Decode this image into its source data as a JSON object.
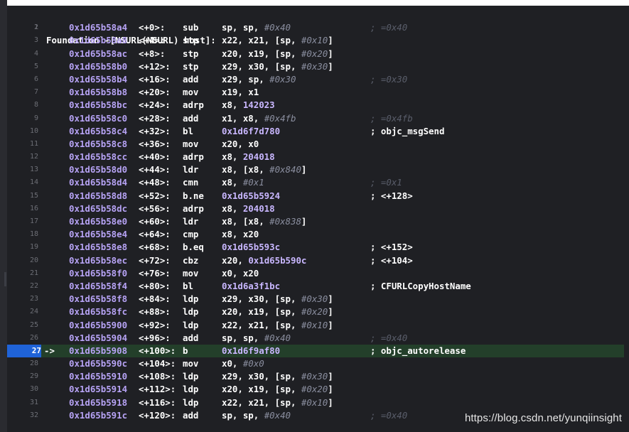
{
  "title": "Foundation`-[NSURL(NSURL) host]:",
  "current_line": 27,
  "arrow": "->",
  "rows": [
    {
      "ln": "2",
      "addr": "0x1d65b58a4",
      "off": "<+0>:",
      "mn": "sub",
      "ops": [
        [
          "sp, sp, ",
          ""
        ],
        [
          "#0x40",
          "i"
        ]
      ],
      "cm": "; =0x40",
      "cmType": "dim"
    },
    {
      "ln": "3",
      "addr": "0x1d65b58a8",
      "off": "<+4>:",
      "mn": "stp",
      "ops": [
        [
          "x22, x21, [sp, ",
          ""
        ],
        [
          "#0x10",
          "i"
        ],
        [
          "]",
          ""
        ]
      ],
      "cm": "",
      "cmType": ""
    },
    {
      "ln": "4",
      "addr": "0x1d65b58ac",
      "off": "<+8>:",
      "mn": "stp",
      "ops": [
        [
          "x20, x19, [sp, ",
          ""
        ],
        [
          "#0x20",
          "i"
        ],
        [
          "]",
          ""
        ]
      ],
      "cm": "",
      "cmType": ""
    },
    {
      "ln": "5",
      "addr": "0x1d65b58b0",
      "off": "<+12>:",
      "mn": "stp",
      "ops": [
        [
          "x29, x30, [sp, ",
          ""
        ],
        [
          "#0x30",
          "i"
        ],
        [
          "]",
          ""
        ]
      ],
      "cm": "",
      "cmType": ""
    },
    {
      "ln": "6",
      "addr": "0x1d65b58b4",
      "off": "<+16>:",
      "mn": "add",
      "ops": [
        [
          "x29, sp, ",
          ""
        ],
        [
          "#0x30",
          "i"
        ]
      ],
      "cm": "; =0x30",
      "cmType": "dim"
    },
    {
      "ln": "7",
      "addr": "0x1d65b58b8",
      "off": "<+20>:",
      "mn": "mov",
      "ops": [
        [
          "x19, x1",
          ""
        ]
      ],
      "cm": "",
      "cmType": ""
    },
    {
      "ln": "8",
      "addr": "0x1d65b58bc",
      "off": "<+24>:",
      "mn": "adrp",
      "ops": [
        [
          "x8, ",
          ""
        ],
        [
          "142023",
          "v"
        ]
      ],
      "cm": "",
      "cmType": ""
    },
    {
      "ln": "9",
      "addr": "0x1d65b58c0",
      "off": "<+28>:",
      "mn": "add",
      "ops": [
        [
          "x1, x8, ",
          ""
        ],
        [
          "#0x4fb",
          "i"
        ]
      ],
      "cm": "; =0x4fb",
      "cmType": "dim"
    },
    {
      "ln": "10",
      "addr": "0x1d65b58c4",
      "off": "<+32>:",
      "mn": "bl",
      "ops": [
        [
          "0x1d6f7d780",
          "v"
        ]
      ],
      "cm": "; objc_msgSend",
      "cmType": "sym"
    },
    {
      "ln": "11",
      "addr": "0x1d65b58c8",
      "off": "<+36>:",
      "mn": "mov",
      "ops": [
        [
          "x20, x0",
          ""
        ]
      ],
      "cm": "",
      "cmType": ""
    },
    {
      "ln": "12",
      "addr": "0x1d65b58cc",
      "off": "<+40>:",
      "mn": "adrp",
      "ops": [
        [
          "x8, ",
          ""
        ],
        [
          "204018",
          "v"
        ]
      ],
      "cm": "",
      "cmType": ""
    },
    {
      "ln": "13",
      "addr": "0x1d65b58d0",
      "off": "<+44>:",
      "mn": "ldr",
      "ops": [
        [
          "x8, [x8, ",
          ""
        ],
        [
          "#0x840",
          "i"
        ],
        [
          "]",
          ""
        ]
      ],
      "cm": "",
      "cmType": ""
    },
    {
      "ln": "14",
      "addr": "0x1d65b58d4",
      "off": "<+48>:",
      "mn": "cmn",
      "ops": [
        [
          "x8, ",
          ""
        ],
        [
          "#0x1",
          "i"
        ]
      ],
      "cm": "; =0x1",
      "cmType": "dim"
    },
    {
      "ln": "15",
      "addr": "0x1d65b58d8",
      "off": "<+52>:",
      "mn": "b.ne",
      "ops": [
        [
          "0x1d65b5924",
          "v"
        ]
      ],
      "cm": "; <+128>",
      "cmType": "sym"
    },
    {
      "ln": "16",
      "addr": "0x1d65b58dc",
      "off": "<+56>:",
      "mn": "adrp",
      "ops": [
        [
          "x8, ",
          ""
        ],
        [
          "204018",
          "v"
        ]
      ],
      "cm": "",
      "cmType": ""
    },
    {
      "ln": "17",
      "addr": "0x1d65b58e0",
      "off": "<+60>:",
      "mn": "ldr",
      "ops": [
        [
          "x8, [x8, ",
          ""
        ],
        [
          "#0x838",
          "i"
        ],
        [
          "]",
          ""
        ]
      ],
      "cm": "",
      "cmType": ""
    },
    {
      "ln": "18",
      "addr": "0x1d65b58e4",
      "off": "<+64>:",
      "mn": "cmp",
      "ops": [
        [
          "x8, x20",
          ""
        ]
      ],
      "cm": "",
      "cmType": ""
    },
    {
      "ln": "19",
      "addr": "0x1d65b58e8",
      "off": "<+68>:",
      "mn": "b.eq",
      "ops": [
        [
          "0x1d65b593c",
          "v"
        ]
      ],
      "cm": "; <+152>",
      "cmType": "sym"
    },
    {
      "ln": "20",
      "addr": "0x1d65b58ec",
      "off": "<+72>:",
      "mn": "cbz",
      "ops": [
        [
          "x20, ",
          ""
        ],
        [
          "0x1d65b590c",
          "v"
        ]
      ],
      "cm": "; <+104>",
      "cmType": "sym"
    },
    {
      "ln": "21",
      "addr": "0x1d65b58f0",
      "off": "<+76>:",
      "mn": "mov",
      "ops": [
        [
          "x0, x20",
          ""
        ]
      ],
      "cm": "",
      "cmType": ""
    },
    {
      "ln": "22",
      "addr": "0x1d65b58f4",
      "off": "<+80>:",
      "mn": "bl",
      "ops": [
        [
          "0x1d6a3f1bc",
          "v"
        ]
      ],
      "cm": "; CFURLCopyHostName",
      "cmType": "sym"
    },
    {
      "ln": "23",
      "addr": "0x1d65b58f8",
      "off": "<+84>:",
      "mn": "ldp",
      "ops": [
        [
          "x29, x30, [sp, ",
          ""
        ],
        [
          "#0x30",
          "i"
        ],
        [
          "]",
          ""
        ]
      ],
      "cm": "",
      "cmType": ""
    },
    {
      "ln": "24",
      "addr": "0x1d65b58fc",
      "off": "<+88>:",
      "mn": "ldp",
      "ops": [
        [
          "x20, x19, [sp, ",
          ""
        ],
        [
          "#0x20",
          "i"
        ],
        [
          "]",
          ""
        ]
      ],
      "cm": "",
      "cmType": ""
    },
    {
      "ln": "25",
      "addr": "0x1d65b5900",
      "off": "<+92>:",
      "mn": "ldp",
      "ops": [
        [
          "x22, x21, [sp, ",
          ""
        ],
        [
          "#0x10",
          "i"
        ],
        [
          "]",
          ""
        ]
      ],
      "cm": "",
      "cmType": ""
    },
    {
      "ln": "26",
      "addr": "0x1d65b5904",
      "off": "<+96>:",
      "mn": "add",
      "ops": [
        [
          "sp, sp, ",
          ""
        ],
        [
          "#0x40",
          "i"
        ]
      ],
      "cm": "; =0x40",
      "cmType": "dim"
    },
    {
      "ln": "27",
      "addr": "0x1d65b5908",
      "off": "<+100>:",
      "mn": "b",
      "ops": [
        [
          "0x1d6f9af80",
          "v"
        ]
      ],
      "cm": "; objc_autorelease",
      "cmType": "sym"
    },
    {
      "ln": "28",
      "addr": "0x1d65b590c",
      "off": "<+104>:",
      "mn": "mov",
      "ops": [
        [
          "x0, ",
          ""
        ],
        [
          "#0x0",
          "i"
        ]
      ],
      "cm": "",
      "cmType": ""
    },
    {
      "ln": "29",
      "addr": "0x1d65b5910",
      "off": "<+108>:",
      "mn": "ldp",
      "ops": [
        [
          "x29, x30, [sp, ",
          ""
        ],
        [
          "#0x30",
          "i"
        ],
        [
          "]",
          ""
        ]
      ],
      "cm": "",
      "cmType": ""
    },
    {
      "ln": "30",
      "addr": "0x1d65b5914",
      "off": "<+112>:",
      "mn": "ldp",
      "ops": [
        [
          "x20, x19, [sp, ",
          ""
        ],
        [
          "#0x20",
          "i"
        ],
        [
          "]",
          ""
        ]
      ],
      "cm": "",
      "cmType": ""
    },
    {
      "ln": "31",
      "addr": "0x1d65b5918",
      "off": "<+116>:",
      "mn": "ldp",
      "ops": [
        [
          "x22, x21, [sp, ",
          ""
        ],
        [
          "#0x10",
          "i"
        ],
        [
          "]",
          ""
        ]
      ],
      "cm": "",
      "cmType": ""
    },
    {
      "ln": "32",
      "addr": "0x1d65b591c",
      "off": "<+120>:",
      "mn": "add",
      "ops": [
        [
          "sp, sp, ",
          ""
        ],
        [
          "#0x40",
          "i"
        ]
      ],
      "cm": "; =0x40",
      "cmType": "dim"
    }
  ],
  "watermark": "https://blog.csdn.net/yunqiinsight",
  "colors": {
    "background": "#1f2024",
    "address": "#b7a3f5",
    "current_line_bg": "#233f2a",
    "line_badge": "#1f63d8"
  }
}
